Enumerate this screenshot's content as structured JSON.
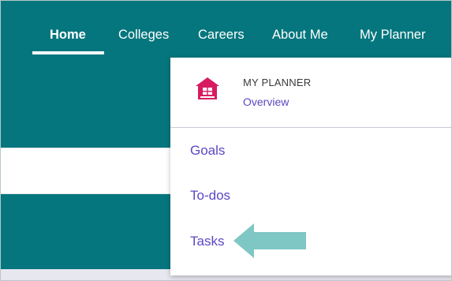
{
  "nav": {
    "items": [
      {
        "label": "Home",
        "active": true
      },
      {
        "label": "Colleges"
      },
      {
        "label": "Careers"
      },
      {
        "label": "About Me"
      },
      {
        "label": "My Planner"
      }
    ]
  },
  "dropdown": {
    "header_title": "MY PLANNER",
    "overview_link": "Overview",
    "header_icon": "house-icon",
    "items": [
      {
        "label": "Goals"
      },
      {
        "label": "To-dos"
      },
      {
        "label": "Tasks"
      }
    ]
  },
  "annotation": {
    "icon": "arrow-left-icon"
  },
  "colors": {
    "teal": "#05767d",
    "link_purple": "#5a48c4",
    "icon_pink": "#d81b60",
    "arrow_teal": "#7fc7c4"
  }
}
